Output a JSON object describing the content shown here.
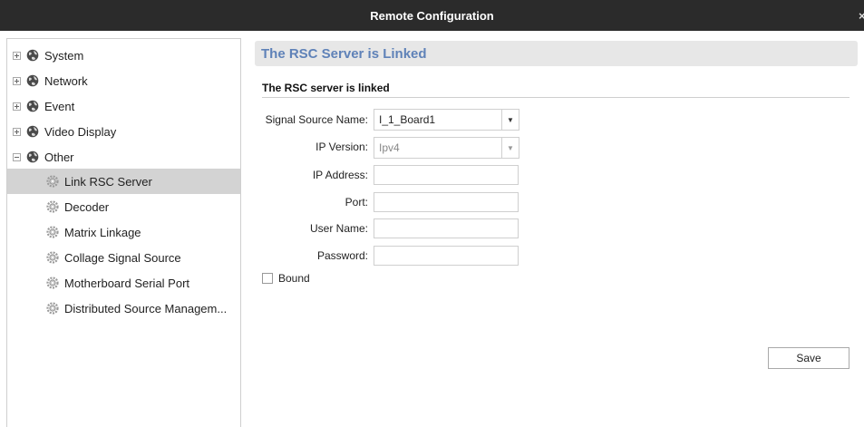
{
  "window": {
    "title": "Remote Configuration",
    "close_glyph": "×"
  },
  "tree": {
    "items": [
      {
        "label": "System",
        "icon": "globe-icon",
        "expander": "plus"
      },
      {
        "label": "Network",
        "icon": "globe-icon",
        "expander": "plus"
      },
      {
        "label": "Event",
        "icon": "globe-icon",
        "expander": "plus"
      },
      {
        "label": "Video Display",
        "icon": "globe-icon",
        "expander": "plus"
      },
      {
        "label": "Other",
        "icon": "globe-icon",
        "expander": "minus"
      }
    ],
    "children": [
      {
        "label": "Link RSC Server",
        "icon": "gear-icon",
        "selected": true
      },
      {
        "label": "Decoder",
        "icon": "gear-icon"
      },
      {
        "label": "Matrix Linkage",
        "icon": "gear-icon"
      },
      {
        "label": "Collage Signal Source",
        "icon": "gear-icon"
      },
      {
        "label": "Motherboard Serial Port",
        "icon": "gear-icon"
      },
      {
        "label": "Distributed Source Managem...",
        "icon": "gear-icon"
      }
    ]
  },
  "panel": {
    "header": "The RSC Server is Linked",
    "section_title": "The RSC server is linked",
    "signal_source_label": "Signal Source Name:",
    "signal_source_value": "I_1_Board1",
    "ip_version_label": "IP Version:",
    "ip_version_value": "Ipv4",
    "ip_address_label": "IP Address:",
    "ip_address_value": "",
    "port_label": "Port:",
    "port_value": "",
    "user_name_label": "User Name:",
    "user_name_value": "",
    "password_label": "Password:",
    "password_value": "",
    "bound_label": "Bound",
    "bound_checked": false,
    "save_label": "Save"
  },
  "colors": {
    "titlebar": "#2b2b2b",
    "header_text": "#5f82b8",
    "header_bg": "#e7e7e7",
    "selection": "#d3d3d3"
  }
}
